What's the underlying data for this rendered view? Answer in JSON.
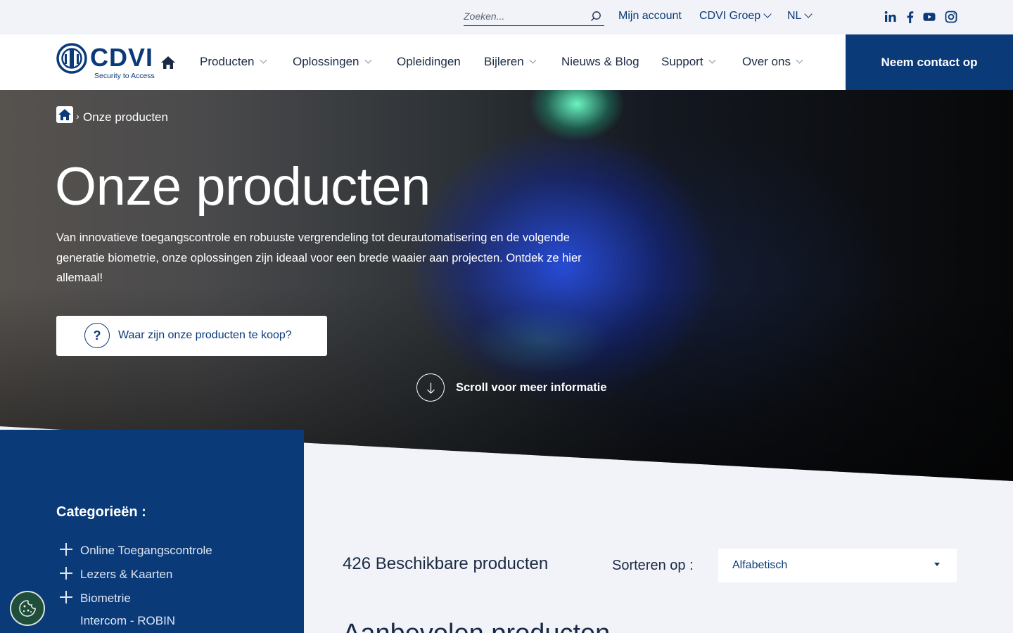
{
  "topbar": {
    "search_placeholder": "Zoeken...",
    "account": "Mijn account",
    "group": "CDVI Groep",
    "language": "NL",
    "social": [
      "linkedin-icon",
      "facebook-icon",
      "youtube-icon",
      "instagram-icon"
    ]
  },
  "logo": {
    "name": "CDVI",
    "tagline": "Security to Access"
  },
  "nav": {
    "items": [
      {
        "label": "Producten",
        "dropdown": true
      },
      {
        "label": "Oplossingen",
        "dropdown": true
      },
      {
        "label": "Opleidingen",
        "dropdown": false
      },
      {
        "label": "Bijleren",
        "dropdown": true
      },
      {
        "label": "Nieuws & Blog",
        "dropdown": false
      },
      {
        "label": "Support",
        "dropdown": true
      },
      {
        "label": "Over ons",
        "dropdown": true
      }
    ],
    "contact": "Neem contact op"
  },
  "hero": {
    "breadcrumb_sep": "›",
    "breadcrumb": "Onze producten",
    "title": "Onze producten",
    "description": "Van innovatieve toegangscontrole en robuuste vergrendeling tot deurautomatisering en de volgende generatie biometrie, onze oplossingen zijn ideaal voor een brede waaier aan projecten. Ontdek ze hier allemaal!",
    "buy_button": "Waar zijn onze producten te koop?",
    "buy_icon": "?",
    "scroll": "Scroll voor meer informatie"
  },
  "sidebar": {
    "title": "Categorieën :",
    "categories": [
      {
        "label": "Online Toegangscontrole",
        "expandable": true
      },
      {
        "label": "Lezers & Kaarten",
        "expandable": true
      },
      {
        "label": "Biometrie",
        "expandable": true
      },
      {
        "label": "Intercom - ROBIN",
        "expandable": false
      }
    ]
  },
  "main": {
    "count": "426 Beschikbare producten",
    "sort_label": "Sorteren op :",
    "sort_value": "Alfabetisch",
    "section_title": "Aanbevolen producten"
  },
  "colors": {
    "primary": "#0a3a78",
    "background": "#f1f3f8",
    "cookie": "#1f4f3a"
  }
}
